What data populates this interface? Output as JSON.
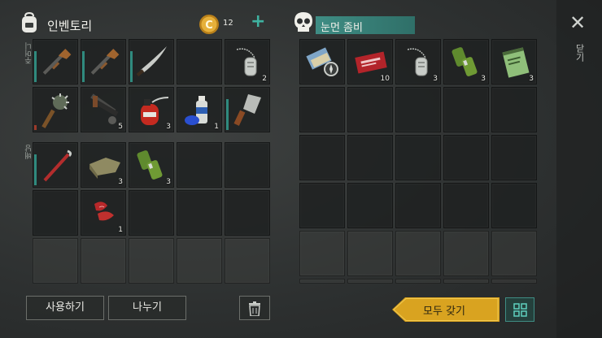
{
  "left_panel": {
    "title": "인벤토리",
    "coin_count": "12",
    "plus_symbol": "+",
    "equip_label": "주머니",
    "backpack_label": "배낭",
    "equip_slots": [
      {
        "item": "shotgun-icon",
        "count": ""
      },
      {
        "item": "shotgun-icon",
        "count": ""
      },
      {
        "item": "machete-icon",
        "count": ""
      },
      {
        "item": "empty",
        "count": ""
      },
      {
        "item": "dog-tag-icon",
        "count": "2"
      },
      {
        "item": "spiked-club-icon",
        "count": ""
      },
      {
        "item": "tool-bundle-icon",
        "count": "5"
      },
      {
        "item": "gas-canister-icon",
        "count": "3"
      },
      {
        "item": "spray-paint-icon",
        "count": "1"
      },
      {
        "item": "cleaver-icon",
        "count": ""
      }
    ],
    "backpack_slots": [
      {
        "item": "crowbar-icon",
        "count": ""
      },
      {
        "item": "cloth-icon",
        "count": "3"
      },
      {
        "item": "battery-icon",
        "count": "3"
      },
      {
        "item": "empty",
        "count": ""
      },
      {
        "item": "empty",
        "count": ""
      },
      {
        "item": "empty",
        "count": ""
      },
      {
        "item": "raw-meat-icon",
        "count": "1"
      }
    ],
    "use_button": "사용하기",
    "split_button": "나누기"
  },
  "right_panel": {
    "title": "눈먼 좀비",
    "loot_slots": [
      {
        "item": "map-compass-icon",
        "count": ""
      },
      {
        "item": "coupon-icon",
        "count": "10"
      },
      {
        "item": "dog-tag-icon",
        "count": "3"
      },
      {
        "item": "battery-icon",
        "count": "3"
      },
      {
        "item": "notebook-icon",
        "count": "3"
      }
    ],
    "take_all_button": "모두 갖기"
  },
  "close_label": "닫기",
  "close_symbol": "✕",
  "colors": {
    "accent_teal": "#2f8a7e",
    "title_bar": "#3f8d84",
    "take_all": "#d9a320",
    "coin": "#d9a02a"
  }
}
